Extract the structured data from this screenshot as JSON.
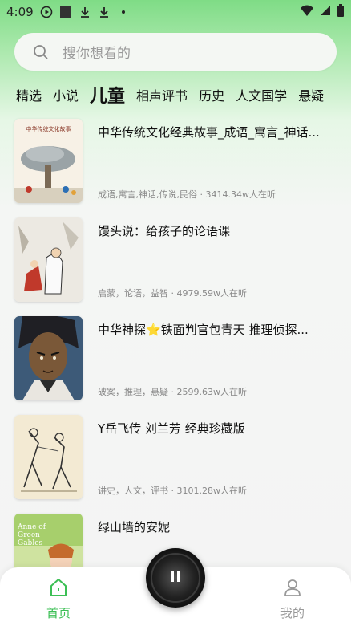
{
  "status_bar": {
    "time": "4:09"
  },
  "search": {
    "placeholder": "搜你想看的"
  },
  "tabs": [
    "精选",
    "小说",
    "儿童",
    "相声评书",
    "历史",
    "人文国学",
    "悬疑"
  ],
  "active_tab": "儿童",
  "items": [
    {
      "title": "中华传统文化经典故事_成语_寓言_神话...",
      "meta": "成语,寓言,神话,传说,民俗 · 3414.34w人在听",
      "cover_text": "中华传统文化故事"
    },
    {
      "title": "馒头说：给孩子的论语课",
      "meta": "启蒙，论语，益智 · 4979.59w人在听"
    },
    {
      "title": "中华神探⭐铁面判官包青天  推理侦探...",
      "meta": "破案，推理，悬疑 · 2599.63w人在听"
    },
    {
      "title": "Y岳飞传  刘兰芳  经典珍藏版",
      "meta": "讲史，人文，评书 · 3101.28w人在听"
    },
    {
      "title": "绿山墙的安妮",
      "meta": "",
      "cover_text": "Anne of Green Gables"
    }
  ],
  "bottom_nav": {
    "home": "首页",
    "mine": "我的"
  },
  "colors": {
    "accent": "#3cbf55",
    "header_green": "#7fdc86"
  }
}
